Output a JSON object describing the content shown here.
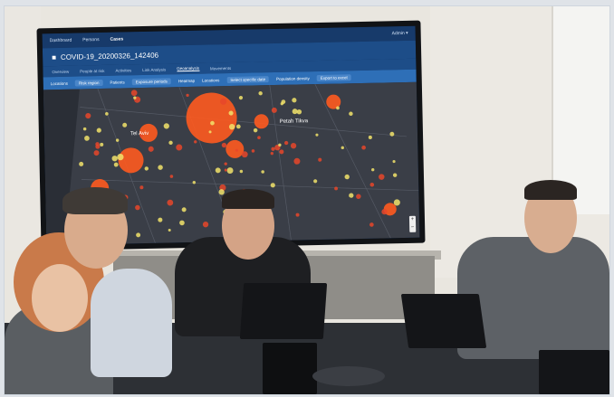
{
  "screen": {
    "topnav": [
      "Dashboard",
      "Persons",
      "Cases"
    ],
    "topnav_active": "Cases",
    "user_menu": "Admin ▾",
    "case_title": "COVID-19_20200326_142406",
    "tabs": [
      "Overview",
      "People at risk",
      "Activities",
      "Link Analysis",
      "Geoanalysis",
      "Movements"
    ],
    "active_tab": "Geoanalysis",
    "toolbar": [
      "Locations",
      "Risk region",
      "Patients",
      "Exposure periods",
      "Heatmap",
      "Locations",
      "Select specific date",
      "Population density",
      "Export to excel"
    ],
    "map_labels": [
      "Tel Aviv",
      "Petah Tikva"
    ]
  },
  "colors": {
    "hotspot": "#ff5a1f",
    "cluster": "#e8462a",
    "point": "#f2e36b",
    "nav": "#173a6a",
    "bar": "#2e6fb7"
  },
  "icons": [
    "briefcase-icon",
    "zoom-plus-icon",
    "zoom-minus-icon"
  ]
}
